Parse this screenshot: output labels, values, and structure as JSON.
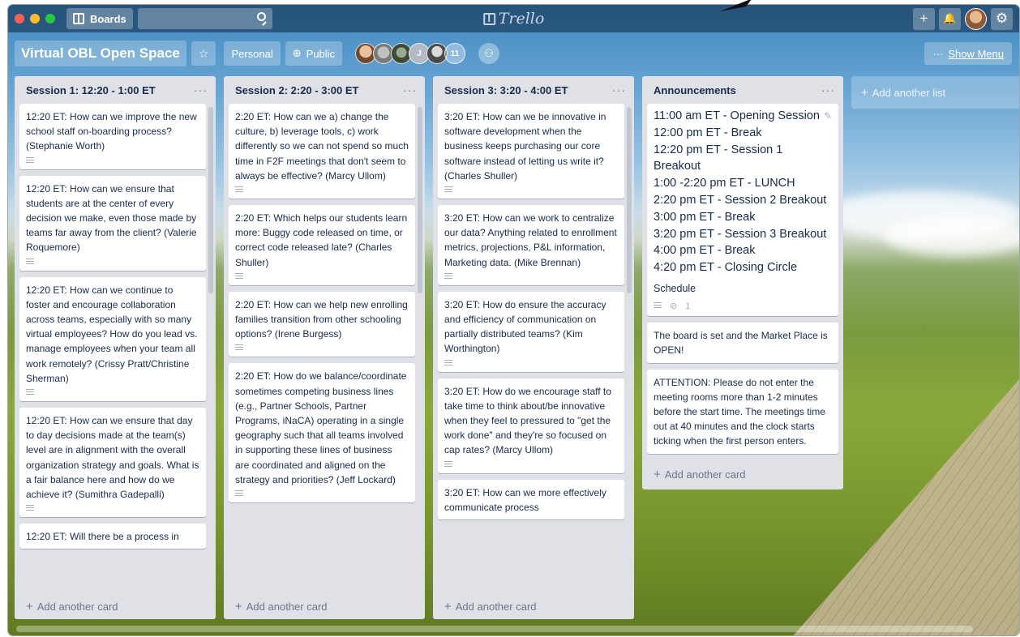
{
  "topbar": {
    "boards_label": "Boards",
    "search_placeholder": "",
    "logo_text": "Trello",
    "add_icon": "+",
    "bell_icon": "🔔",
    "gear_icon": "⚙"
  },
  "board": {
    "title": "Virtual OBL Open Space",
    "visibility_team": "Personal",
    "visibility_public": "Public",
    "member_initial": "J",
    "member_count": "11",
    "show_menu": "Show Menu",
    "show_menu_dots": "···"
  },
  "lists": [
    {
      "title": "Session 1: 12:20 - 1:00 ET",
      "cards": [
        "12:20 ET: How can we improve the new school staff on-boarding process? (Stephanie Worth)",
        "12:20 ET: How can we ensure that students are at the center of every decision we make, even those made by teams far away from the client? (Valerie Roquemore)",
        "12:20 ET: How can we continue to foster and encourage collaboration across teams, especially with so many virtual employees? How do you lead vs. manage employees when your team all work remotely? (Crissy Pratt/Christine Sherman)",
        "12:20 ET: How can we ensure that day to day decisions made at the team(s) level are in alignment with the overall organization strategy and goals. What is a fair balance here and how do we achieve it? (Sumithra Gadepalli)",
        "12:20 ET: Will there be a process in"
      ],
      "add_card": "Add another card"
    },
    {
      "title": "Session 2: 2:20 - 3:00 ET",
      "cards": [
        "2:20 ET: How can we a) change the culture, b) leverage tools, c) work differently so we can not spend so much time in F2F meetings that don't seem to always be effective? (Marcy Ullom)",
        "2:20 ET: Which helps our students learn more: Buggy code released on time, or correct code released late? (Charles Shuller)",
        "2:20 ET: How can we help new enrolling families transition from other schooling options? (Irene Burgess)",
        "2:20 ET: How do we balance/coordinate sometimes competing business lines (e.g., Partner Schools, Partner Programs, iNaCA) operating in a single geography such that all teams involved in supporting these lines of business are coordinated and aligned on the strategy and priorities? (Jeff Lockard)"
      ],
      "add_card": "Add another card"
    },
    {
      "title": "Session 3: 3:20 - 4:00 ET",
      "cards": [
        "3:20 ET: How can we be innovative in software development when the business keeps purchasing our core software instead of letting us write it? (Charles Shuller)",
        "3:20 ET: How can we work to centralize our data? Anything related to enrollment metrics, projections, P&L information, Marketing data. (Mike Brennan)",
        "3:20 ET: How do ensure the accuracy and efficiency of communication on partially distributed teams? (Kim Worthington)",
        "3:20 ET: How do we encourage staff to take time to think about/be innovative when they feel to pressured to \"get the work done\" and they're so focused on cap rates? (Marcy Ullom)",
        "3:20 ET: How can we more effectively communicate process"
      ],
      "add_card": "Add another card"
    }
  ],
  "announcements": {
    "title": "Announcements",
    "schedule": [
      "11:00 am ET - Opening Session",
      "12:00 pm ET - Break",
      "12:20 pm ET - Session 1 Breakout",
      "1:00 -2:20 pm ET - LUNCH",
      "2:20 pm ET - Session 2 Breakout",
      "3:00 pm ET - Break",
      "3:20 pm ET - Session 3 Breakout",
      "4:00 pm ET - Break",
      "4:20 pm ET - Closing Circle"
    ],
    "schedule_label": "Schedule",
    "attachment_count": "1",
    "card2": "The board is set and the Market Place is OPEN!",
    "card3": "ATTENTION: Please do not enter the meeting rooms more than 1-2 minutes before the start time. The meetings time out at 40 minutes and the clock starts ticking when the first person enters.",
    "add_card": "Add another card"
  },
  "add_list": "Add another list",
  "list_menu": "···"
}
